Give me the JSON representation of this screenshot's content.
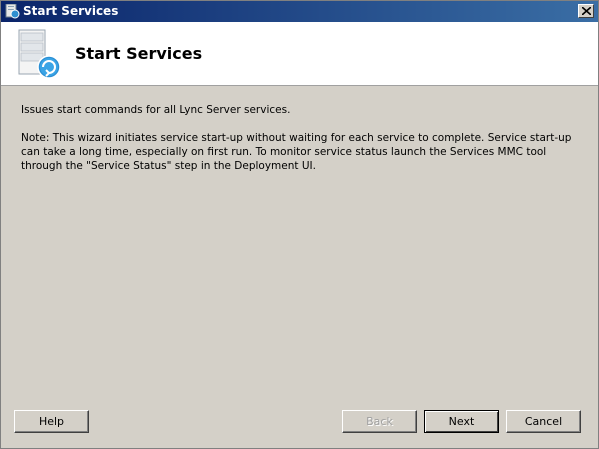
{
  "window": {
    "title": "Start Services",
    "icon": "window-app-icon"
  },
  "header": {
    "title": "Start Services",
    "icon": "server-start-icon"
  },
  "content": {
    "description": "Issues start commands for all Lync Server services.",
    "note": "Note: This wizard initiates service start-up without waiting for each service to complete. Service start-up can take a long time, especially on first run. To monitor service status launch the Services MMC tool through the \"Service Status\" step in the Deployment UI."
  },
  "buttons": {
    "help": "Help",
    "back": "Back",
    "next": "Next",
    "cancel": "Cancel"
  },
  "colors": {
    "titlebar_start": "#0a246a",
    "titlebar_end": "#3a6ea5",
    "dialog_bg": "#d4d0c8",
    "header_bg": "#ffffff"
  }
}
